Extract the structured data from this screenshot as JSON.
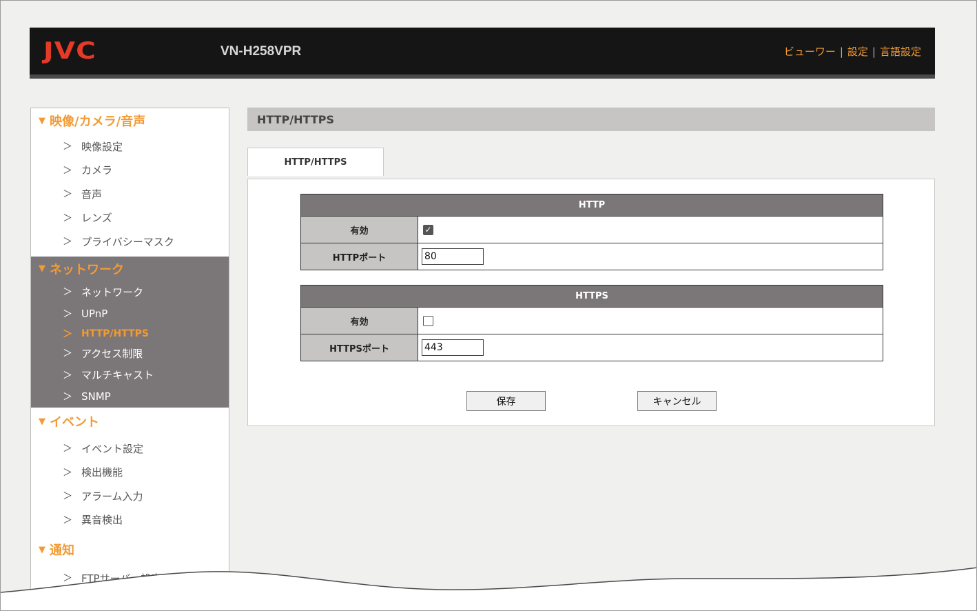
{
  "header": {
    "logo": "JVC",
    "model": "VN-H258VPR",
    "nav": [
      {
        "label": "ビューワー"
      },
      {
        "label": "設定"
      },
      {
        "label": "言語設定"
      }
    ],
    "separator": "|"
  },
  "sidebar": {
    "sections": [
      {
        "title": "映像/カメラ/音声",
        "items": [
          "映像設定",
          "カメラ",
          "音声",
          "レンズ",
          "プライバシーマスク"
        ]
      },
      {
        "title": "ネットワーク",
        "items": [
          "ネットワーク",
          "UPnP",
          "HTTP/HTTPS",
          "アクセス制限",
          "マルチキャスト",
          "SNMP"
        ]
      },
      {
        "title": "イベント",
        "items": [
          "イベント設定",
          "検出機能",
          "アラーム入力",
          "異音検出"
        ]
      },
      {
        "title": "通知",
        "items": [
          "FTPサーバー設定"
        ]
      }
    ],
    "arrow": "＞",
    "triangle": "▼"
  },
  "main": {
    "title": "HTTP/HTTPS",
    "tab": "HTTP/HTTPS",
    "http": {
      "heading": "HTTP",
      "enable_label": "有効",
      "enabled": true,
      "port_label": "HTTPポート",
      "port_value": "80"
    },
    "https": {
      "heading": "HTTPS",
      "enable_label": "有効",
      "enabled": false,
      "port_label": "HTTPSポート",
      "port_value": "443"
    },
    "save_label": "保存",
    "cancel_label": "キャンセル"
  },
  "colors": {
    "accent": "#f29b35",
    "logo": "#e53a28",
    "header_bg": "#151515",
    "active_section_bg": "#7b7678"
  }
}
